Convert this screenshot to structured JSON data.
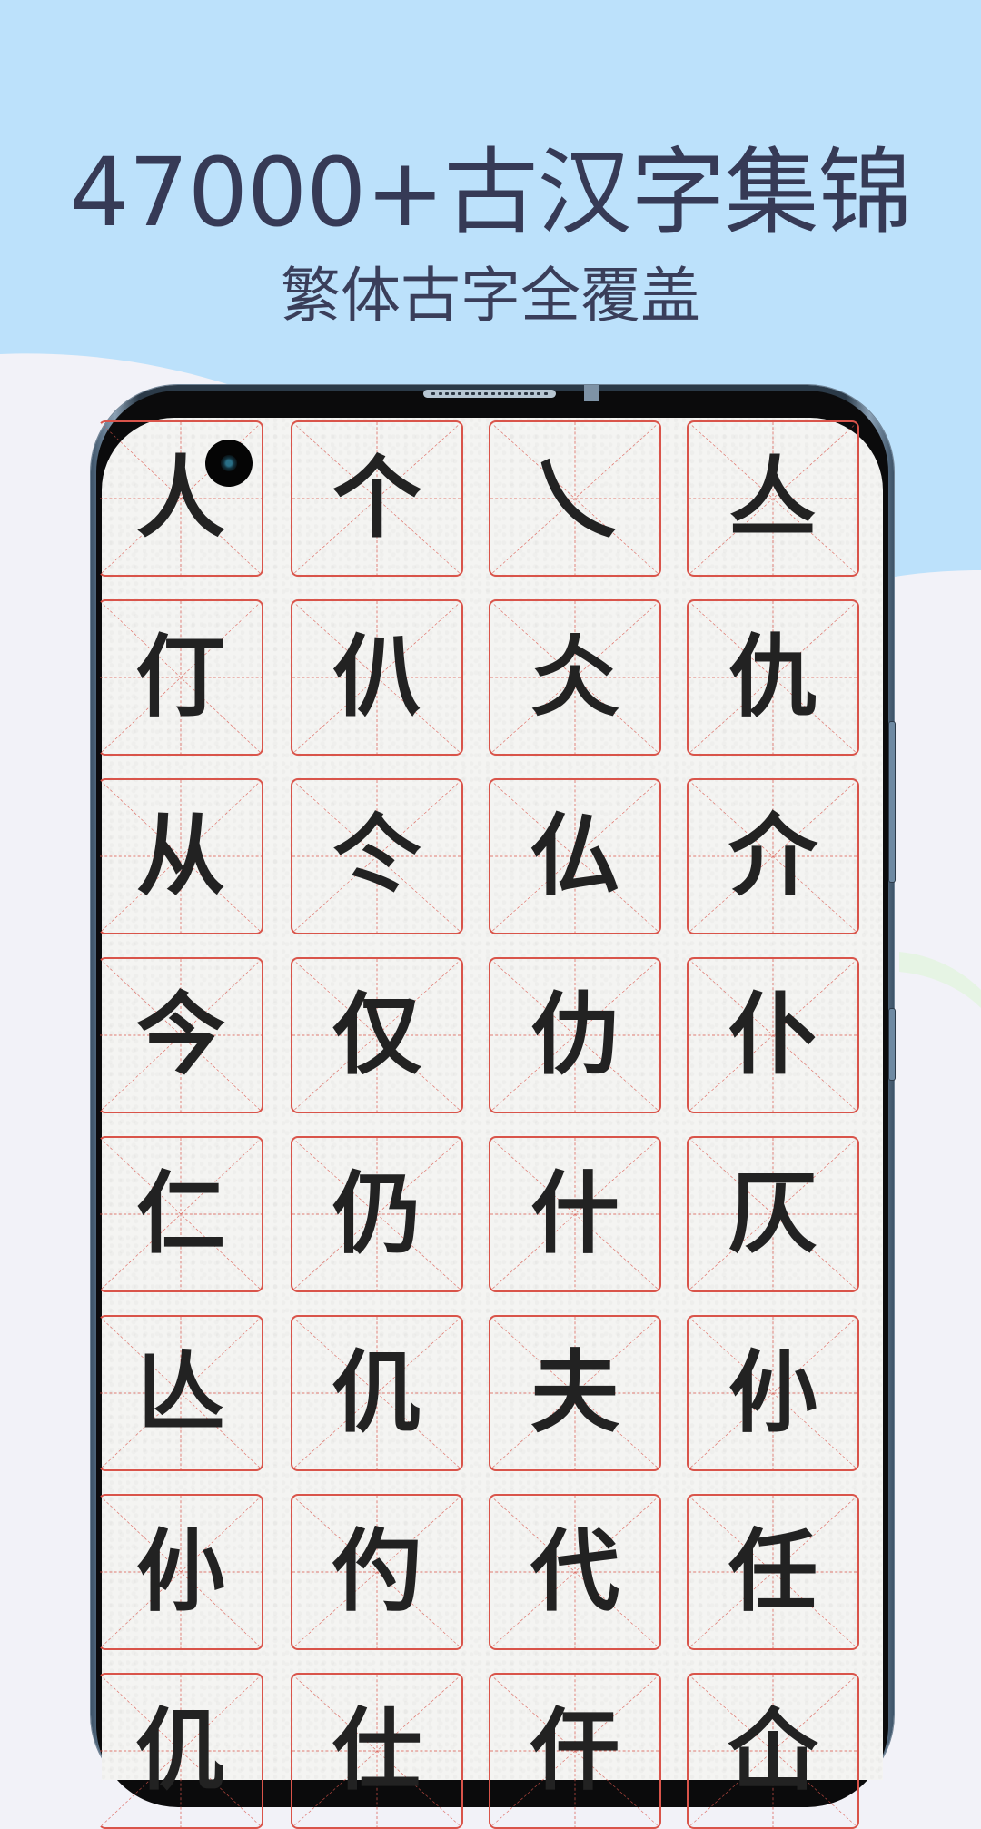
{
  "header": {
    "headline": "47000+古汉字集锦",
    "subheadline": "繁体古字全覆盖"
  },
  "colors": {
    "background_top": "#bce1fb",
    "background_bottom": "#f2f2f8",
    "headline_text": "#363a56",
    "grid_red": "#d9544a",
    "glyph": "#222222",
    "accent_green_arc": "#e6f4e4"
  },
  "phone": {
    "front_camera_icon": "camera-icon",
    "speaker_icon": "speaker-grill-icon"
  },
  "character_grid": {
    "columns": 4,
    "cell_style": "mi-zi-ge",
    "rows": [
      [
        "人",
        "个",
        "乀",
        "亼"
      ],
      [
        "仃",
        "仈",
        "仌",
        "仇"
      ],
      [
        "从",
        "仒",
        "仏",
        "介"
      ],
      [
        "今",
        "仅",
        "仂",
        "仆"
      ],
      [
        "仁",
        "仍",
        "什",
        "仄"
      ],
      [
        "亾",
        "仉",
        "夫",
        "仦"
      ],
      [
        "仦",
        "仢",
        "代",
        "任"
      ],
      [
        "仉",
        "仕",
        "仠",
        "仚"
      ]
    ]
  }
}
